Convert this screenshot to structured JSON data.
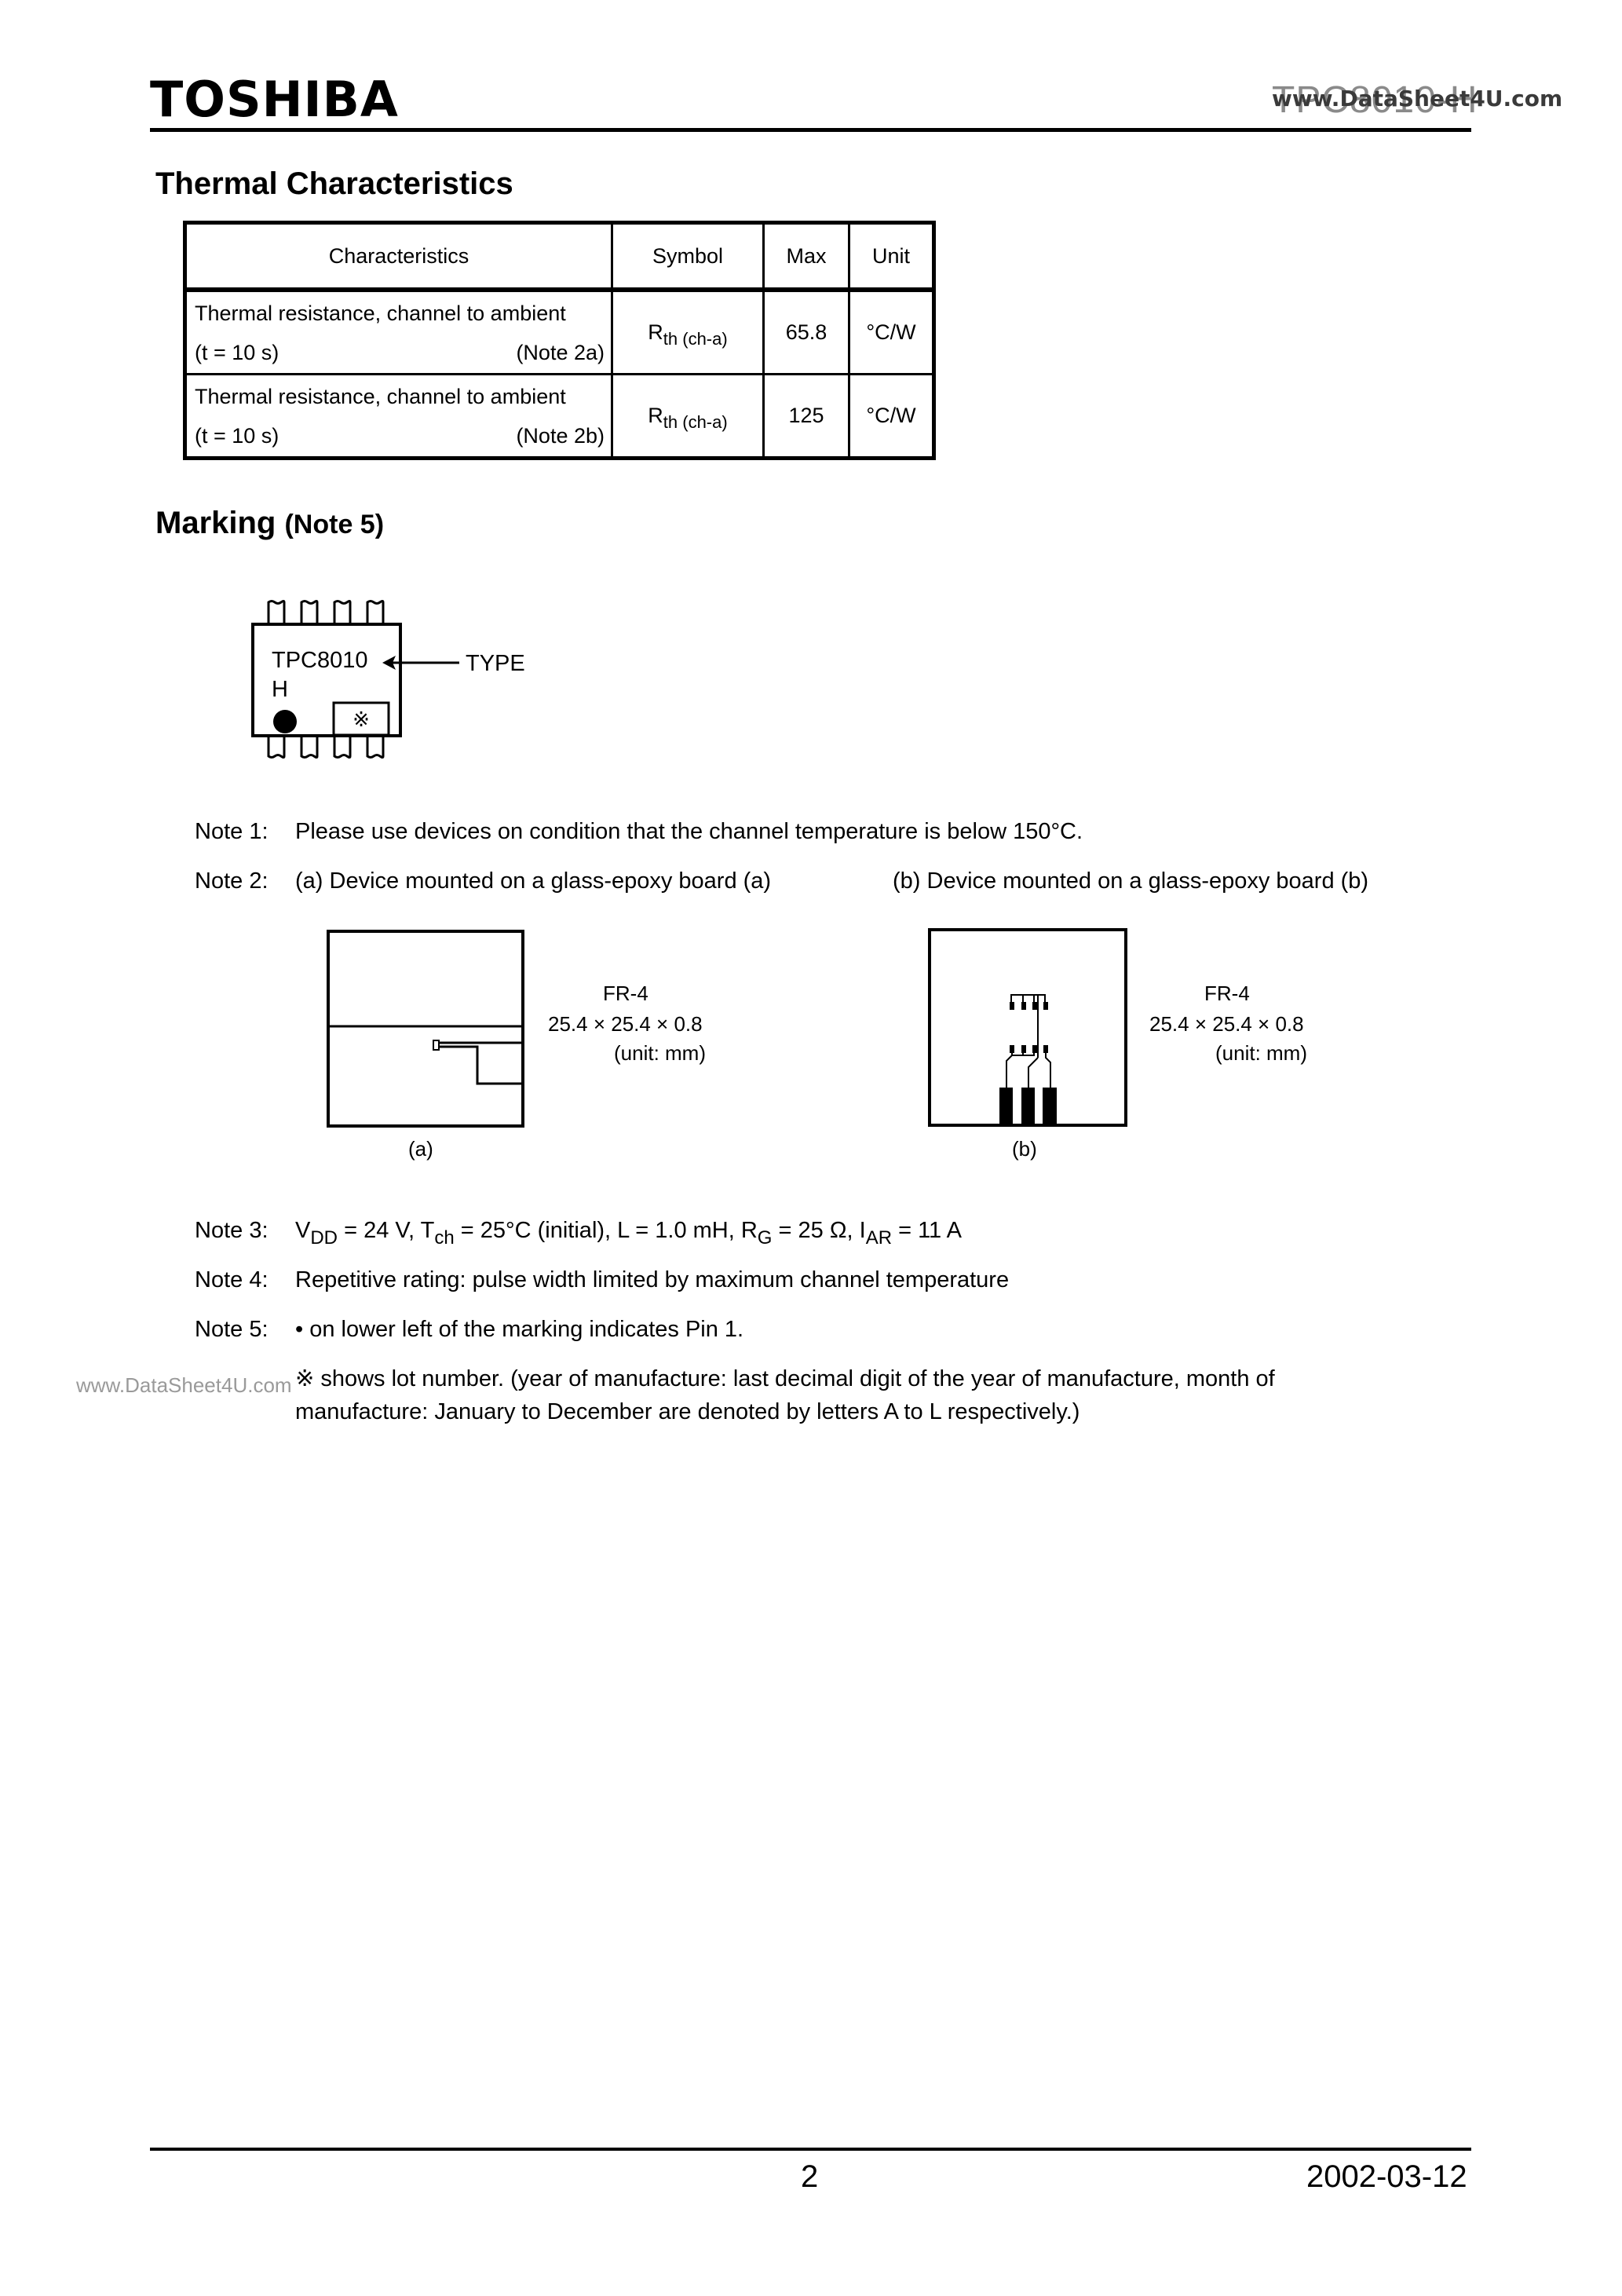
{
  "header": {
    "brand": "TOSHIBA",
    "part_number": "TPC8010-H",
    "watermark": "www.DataSheet4U.com"
  },
  "thermal": {
    "title": "Thermal Characteristics",
    "columns": [
      "Characteristics",
      "Symbol",
      "Max",
      "Unit"
    ],
    "rows": [
      {
        "characteristic": "Thermal resistance, channel to ambient",
        "condition": "(t = 10 s)",
        "note": "(Note 2a)",
        "symbol_main": "R",
        "symbol_sub": "th (ch-a)",
        "max": "65.8",
        "unit": "°C/W"
      },
      {
        "characteristic": "Thermal resistance, channel to ambient",
        "condition": "(t = 10 s)",
        "note": "(Note 2b)",
        "symbol_main": "R",
        "symbol_sub": "th (ch-a)",
        "max": "125",
        "unit": "°C/W"
      }
    ]
  },
  "marking": {
    "title": "Marking",
    "title_note": "(Note 5)",
    "type_text": "TPC8010",
    "suffix": "H",
    "lot_symbol": "※",
    "type_label": "TYPE"
  },
  "notes": {
    "n1_label": "Note 1:",
    "n1_text": "Please use devices on condition that the channel temperature is below 150°C.",
    "n2_label": "Note 2:",
    "n2_a": "(a) Device mounted on a glass-epoxy board (a)",
    "n2_b": "(b) Device mounted on a glass-epoxy board (b)",
    "n3_label": "Note 3:",
    "n3_parts": {
      "v": "V",
      "v_sub": "DD",
      "v_val": " = 24 V, T",
      "t_sub": "ch",
      "t_val": " = 25°C (initial), L = 1.0 mH, R",
      "r_sub": "G",
      "r_val": " = 25 Ω, I",
      "i_sub": "AR",
      "i_val": " = 11 A"
    },
    "n4_label": "Note 4:",
    "n4_text": "Repetitive rating: pulse width limited by maximum channel temperature",
    "n5_label": "Note 5:",
    "n5_text": "• on lower left of the marking indicates Pin 1.",
    "n5_lot_line1": "※  shows lot number. (year of manufacture: last decimal digit of the year of manufacture, month of",
    "n5_lot_line2": "manufacture: January to December are denoted by letters A to L respectively.)",
    "side_watermark": "www.DataSheet4U.com"
  },
  "boards": {
    "a": {
      "material": "FR-4",
      "dims": "25.4 × 25.4 × 0.8",
      "unit": "(unit: mm)",
      "caption": "(a)"
    },
    "b": {
      "material": "FR-4",
      "dims": "25.4 × 25.4 × 0.8",
      "unit": "(unit: mm)",
      "caption": "(b)"
    }
  },
  "footer": {
    "page": "2",
    "date": "2002-03-12"
  }
}
